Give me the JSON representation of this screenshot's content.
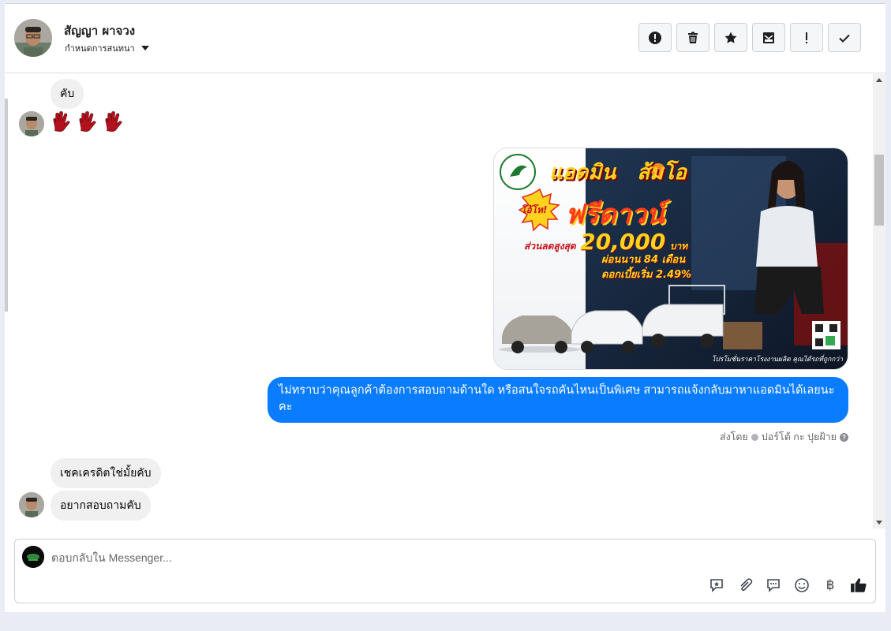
{
  "header": {
    "contact_name": "สัญญา ผาจวง",
    "assign_label": "กำหนดการสนทนา",
    "actions": [
      {
        "name": "report-spam-button",
        "icon": "exclamation-circle-icon"
      },
      {
        "name": "delete-button",
        "icon": "trash-icon"
      },
      {
        "name": "star-button",
        "icon": "star-icon"
      },
      {
        "name": "mark-unread-button",
        "icon": "envelope-icon"
      },
      {
        "name": "follow-up-button",
        "icon": "exclamation-icon"
      },
      {
        "name": "mark-done-button",
        "icon": "checkmark-icon"
      }
    ]
  },
  "messages": {
    "incoming_1": "คับ",
    "incoming_stickers": [
      "glove-icon",
      "glove-icon",
      "glove-icon"
    ],
    "outgoing_reply": "ไม่ทราบว่าคุณลูกค้าต้องการสอบถามด้านใด หรือสนใจรถคันไหนเป็นพิเศษ สามารถแจ้งกลับมาหาแอดมินได้เลยนะคะ",
    "sent_by_prefix": "ส่งโดย",
    "sent_by_name": "ปอร์โต้ กะ ปุยฝ้าย",
    "incoming_2": "เชคเครดิตใช่มั้ยคับ",
    "incoming_3": "อยากสอบถามคับ"
  },
  "ad_image": {
    "title_1": "แอดมิน",
    "title_2": "ส้มโอ",
    "badge": "โอ้โห!",
    "headline": "ฟรีดาวน์",
    "discount_label": "ส่วนลดสูงสุด",
    "discount_value": "20,000",
    "discount_unit": "บาท",
    "installment": "ผ่อนนาน 84 เดือน",
    "interest": "ดอกเบี้ยเริ่ม 2.49%",
    "footer": "โปรโมชั่นราคาโรงงานผลิต คุณได้รถที่ถูกกว่า",
    "colors": {
      "title": "#ffd21f",
      "headline": "#ff3b1a",
      "shadow": "#7a0000"
    }
  },
  "composer": {
    "placeholder": "ตอบกลับใน Messenger...",
    "tools": [
      "saved-reply-icon",
      "attachment-icon",
      "chat-bubble-icon",
      "emoji-icon",
      "baht-icon",
      "thumbs-up-icon"
    ]
  },
  "colors": {
    "accent": "#0a7cff",
    "incoming_bubble": "#f0f0f0"
  }
}
